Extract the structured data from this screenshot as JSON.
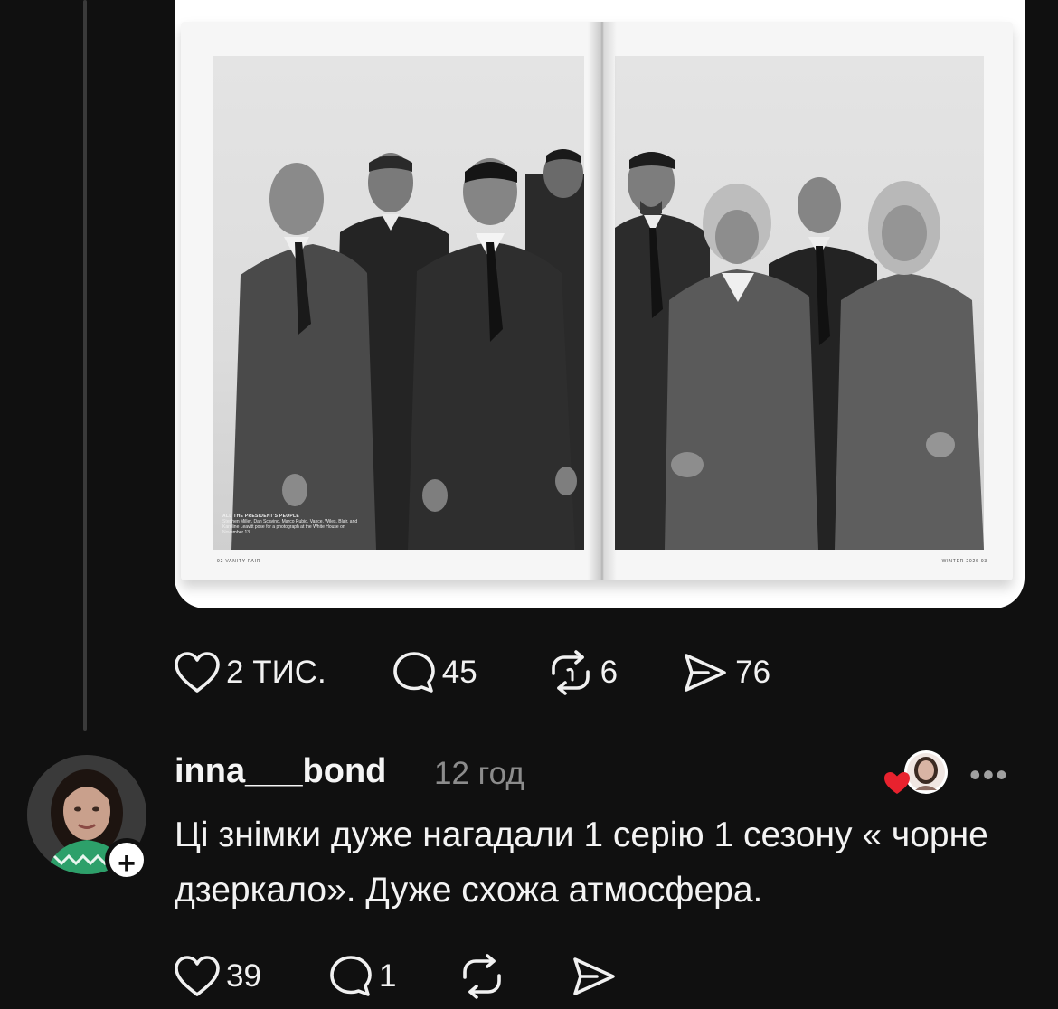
{
  "post": {
    "image": {
      "caption_title": "ALL THE PRESIDENT'S PEOPLE",
      "caption_body": "Stephen Miller, Dan Scavino, Marco Rubio, Vance, Wiles, Blair, and Karoline Leavitt pose for a photograph at the White House on November 13.",
      "folio_left": "92   VANITY FAIR",
      "folio_right": "WINTER 2026   93"
    },
    "actions": {
      "likes": "2 ТИС.",
      "comments": "45",
      "reposts": "6",
      "shares": "76"
    }
  },
  "comment": {
    "username": "inna___bond",
    "timestamp": "12 год",
    "text": "Ці знімки дуже нагадали 1 серію 1 сезону « чорне дзеркало». Дуже схожа атмосфера.",
    "follow_label": "+",
    "more_label": "•••",
    "actions": {
      "likes": "39",
      "comments": "1"
    }
  },
  "colors": {
    "background": "#101010",
    "text": "#f3f3f3",
    "muted": "#8c8c8c",
    "heart": "#e8222e"
  },
  "icons": [
    "heart-icon",
    "comment-icon",
    "repost-icon",
    "share-icon",
    "plus-icon",
    "more-icon"
  ]
}
